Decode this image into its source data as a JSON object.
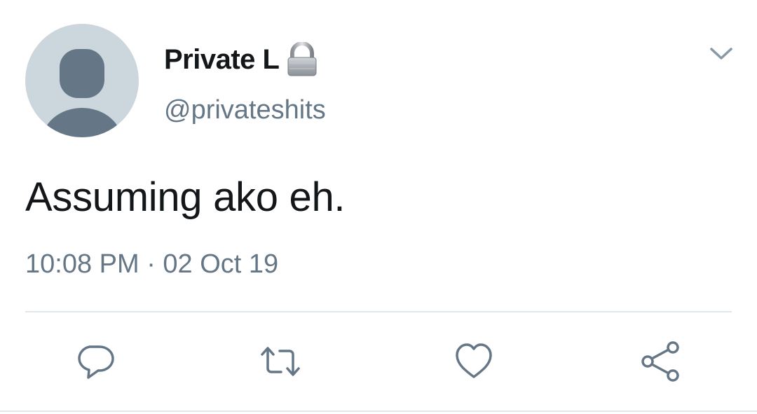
{
  "tweet": {
    "display_name": "Private L",
    "handle": "@privateshits",
    "text": "Assuming ako eh.",
    "timestamp": "10:08 PM · 02 Oct 19"
  },
  "icons": {
    "avatar": "default-avatar-icon",
    "protected": "lock-icon",
    "menu": "chevron-down-icon",
    "reply": "reply-icon",
    "retweet": "retweet-icon",
    "like": "heart-icon",
    "share": "share-icon"
  },
  "colors": {
    "text_primary": "#14171a",
    "text_secondary": "#657786",
    "avatar_bg": "#ccd6dd",
    "avatar_fg": "#657786",
    "divider": "#e1e8ed"
  }
}
